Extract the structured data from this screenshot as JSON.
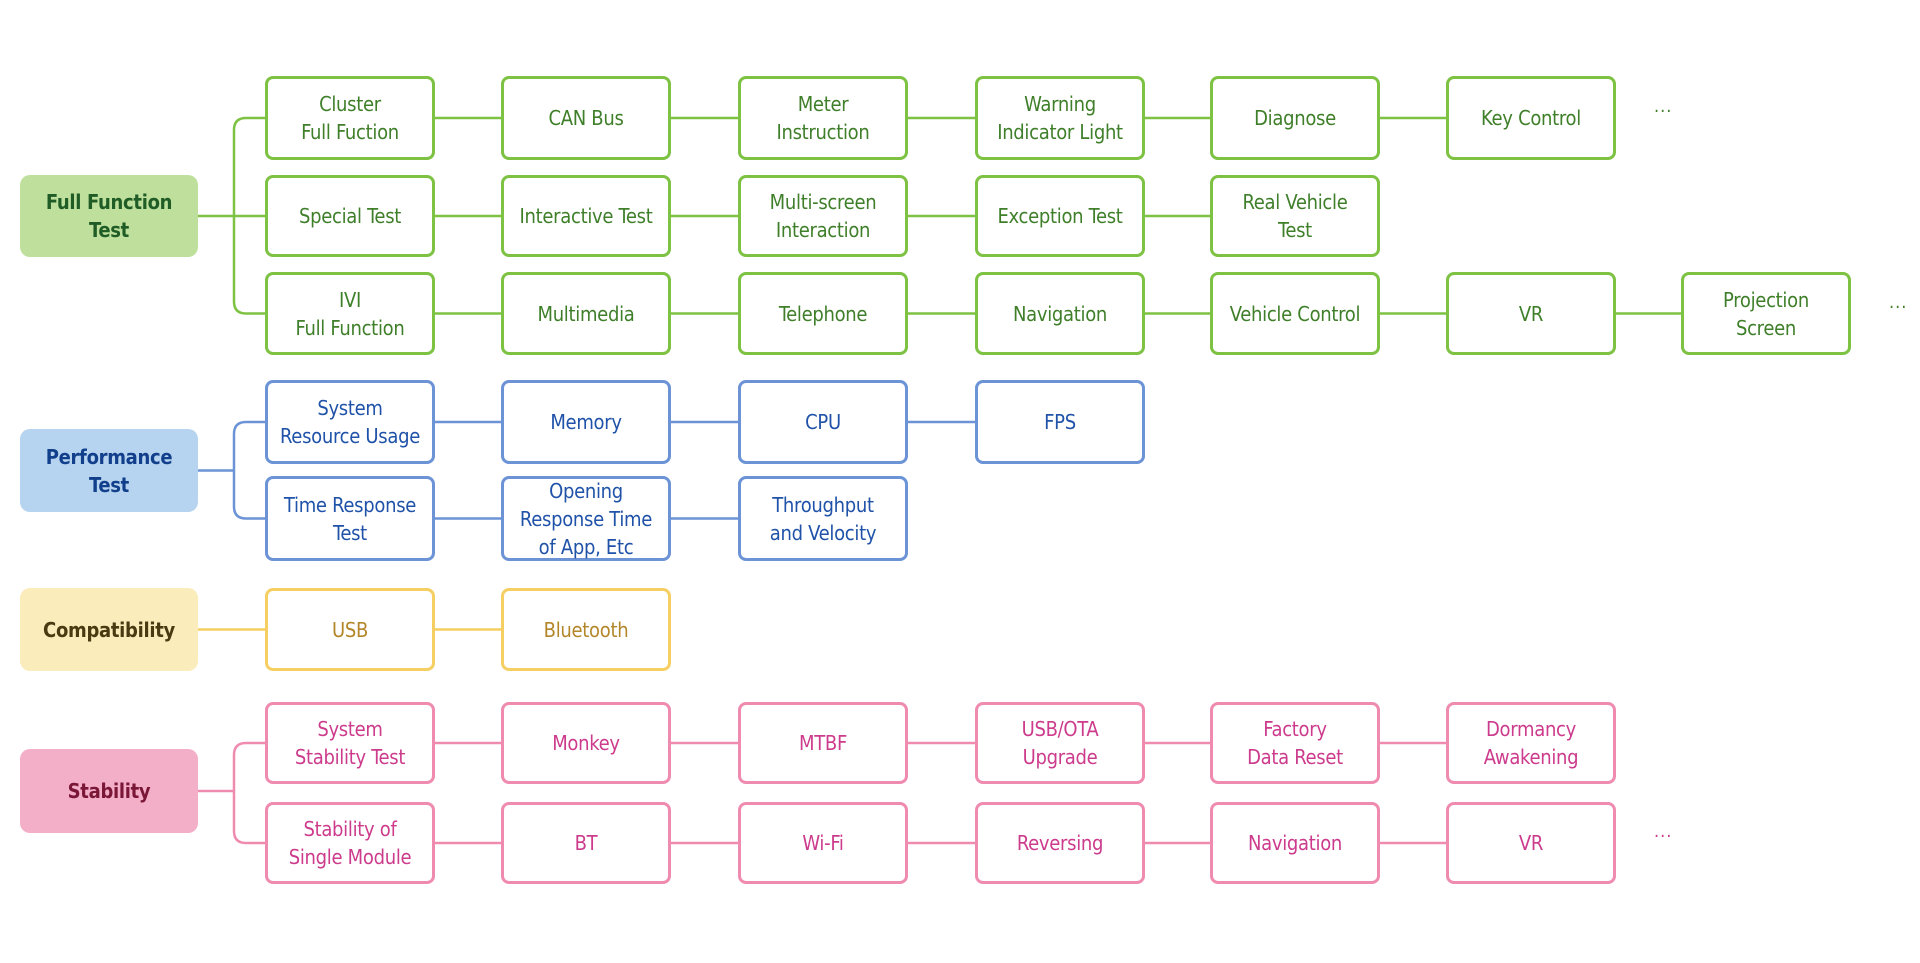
{
  "groups": [
    {
      "id": "full-function",
      "label": "Full Function\nTest",
      "colors": {
        "line": "#7dc242",
        "text": "#3f7f2a",
        "root_bg": "#bfdf9c",
        "root_text": "#1f5c26"
      },
      "rows": [
        {
          "items": [
            "Cluster\nFull Fuction",
            "CAN Bus",
            "Meter\nInstruction",
            "Warning\nIndicator Light",
            "Diagnose",
            "Key Control"
          ],
          "more": "..."
        },
        {
          "items": [
            "Special Test",
            "Interactive Test",
            "Multi-screen\nInteraction",
            "Exception Test",
            "Real Vehicle\nTest"
          ],
          "more": null
        },
        {
          "items": [
            "IVI\nFull Function",
            "Multimedia",
            "Telephone",
            "Navigation",
            "Vehicle Control",
            "VR",
            "Projection\nScreen"
          ],
          "more": "..."
        }
      ]
    },
    {
      "id": "performance",
      "label": "Performance\nTest",
      "colors": {
        "line": "#6b93d6",
        "text": "#1f52a8",
        "root_bg": "#b6d4ef",
        "root_text": "#123f8c"
      },
      "rows": [
        {
          "items": [
            "System\nResource Usage",
            "Memory",
            "CPU",
            "FPS"
          ],
          "more": null
        },
        {
          "items": [
            "Time Response\nTest",
            "Opening\nResponse Time\nof App, Etc",
            "Throughput\nand Velocity"
          ],
          "more": null
        }
      ]
    },
    {
      "id": "compatibility",
      "label": "Compatibility",
      "colors": {
        "line": "#f5cf62",
        "text": "#b3862a",
        "root_bg": "#fbecbc",
        "root_text": "#4a3a12"
      },
      "rows": [
        {
          "items": [
            "USB",
            "Bluetooth"
          ],
          "more": null
        }
      ]
    },
    {
      "id": "stability",
      "label": "Stability",
      "colors": {
        "line": "#f08bb0",
        "text": "#cc3b8c",
        "root_bg": "#f4afc8",
        "root_text": "#7a1636"
      },
      "rows": [
        {
          "items": [
            "System\nStability Test",
            "Monkey",
            "MTBF",
            "USB/OTA\nUpgrade",
            "Factory\nData Reset",
            "Dormancy\nAwakening"
          ],
          "more": null
        },
        {
          "items": [
            "Stability of\nSingle Module",
            "BT",
            "Wi-Fi",
            "Reversing",
            "Navigation",
            "VR"
          ],
          "more": "..."
        }
      ]
    }
  ]
}
